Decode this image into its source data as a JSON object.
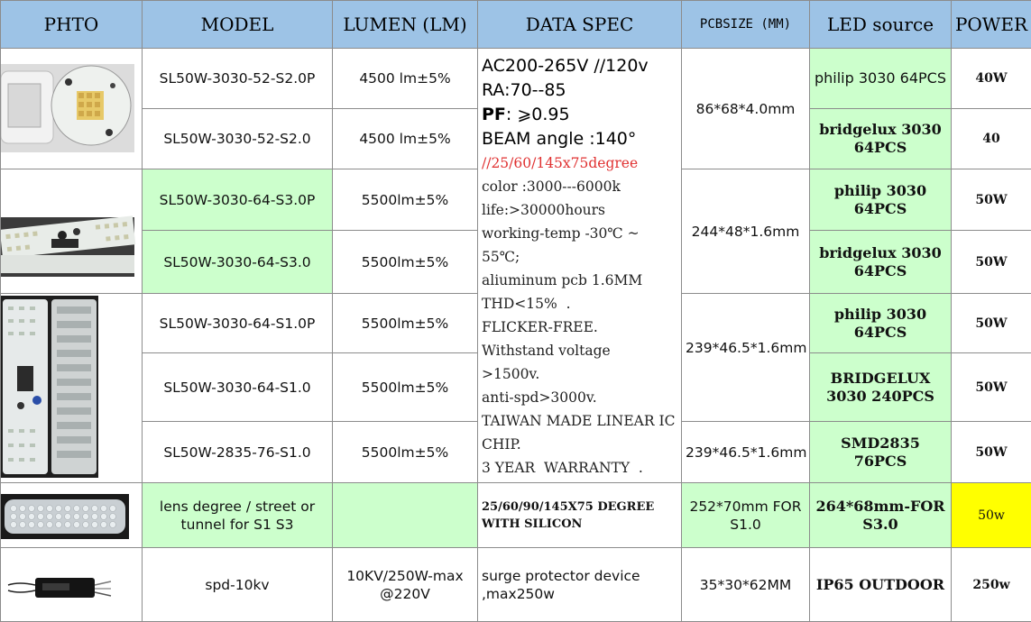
{
  "headers": {
    "photo": "PHTO",
    "model": "MODEL",
    "lumen": "LUMEN (LM)",
    "spec": "DATA SPEC",
    "pcbsize": "PCBSIZE (MM)",
    "led": "LED source",
    "power": "POWER"
  },
  "rows": [
    {
      "model": "SL50W-3030-52-S2.0P",
      "lumen": "4500 lm±5%",
      "led": "philip  3030 64PCS",
      "power": "40W"
    },
    {
      "model": "SL50W-3030-52-S2.0",
      "lumen": "4500 lm±5%",
      "led": "bridgelux 3030 64PCS",
      "power": "40"
    },
    {
      "model": "SL50W-3030-64-S3.0P",
      "lumen": "5500lm±5%",
      "led": "philip  3030 64PCS",
      "power": "50W"
    },
    {
      "model": "SL50W-3030-64-S3.0",
      "lumen": "5500lm±5%",
      "led": "bridgelux 3030 64PCS",
      "power": "50W"
    },
    {
      "model": "SL50W-3030-64-S1.0P",
      "lumen": "5500lm±5%",
      "led": "philip  3030 64PCS",
      "power": "50W"
    },
    {
      "model": "SL50W-3030-64-S1.0",
      "lumen": "5500lm±5%",
      "led": "BRIDGELUX 3030 240PCS",
      "power": "50W"
    },
    {
      "model": "SL50W-2835-76-S1.0",
      "lumen": "5500lm±5%",
      "led": "SMD2835 76PCS",
      "power": "50W"
    }
  ],
  "pcbsizes": [
    "86*68*4.0mm",
    "244*48*1.6mm",
    "239*46.5*1.6mm",
    "239*46.5*1.6mm"
  ],
  "spec": {
    "line1": "AC200-265V //120v",
    "line2": "RA:70--85",
    "pf_label": "PF",
    "pf_value": ": ⩾0.95",
    "beam": "BEAM angle :140°",
    "degree": "//25/60/145x75degree",
    "lines": [
      "color :3000---6000k",
      "life:>30000hours",
      "working-temp -30℃ ~",
      "55℃;",
      "aliuminum pcb 1.6MM",
      "THD<15%  .",
      "FLICKER-FREE.",
      "Withstand voltage",
      ">1500v.",
      "anti-spd>3000v.",
      "TAIWAN MADE LINEAR IC",
      "CHIP.",
      "3 YEAR  WARRANTY  ."
    ]
  },
  "lens": {
    "model": "lens degree / street or tunnel for S1  S3",
    "spec": "25/60/90/145X75 DEGREE WITH SILICON",
    "pcbsize": "252*70mm FOR S1.0",
    "led": "264*68mm-FOR S3.0",
    "power": "50w"
  },
  "surge": {
    "model": "spd-10kv",
    "lumen": "10KV/250W-max @220V",
    "spec": "surge protector device ,max250w",
    "pcbsize": "35*30*62MM",
    "led": "IP65 OUTDOOR",
    "power": "250w"
  },
  "colors": {
    "header_bg": "#9dc3e6",
    "green": "#ccffcc",
    "yellow": "#ffff00",
    "red_text": "#e03030"
  }
}
